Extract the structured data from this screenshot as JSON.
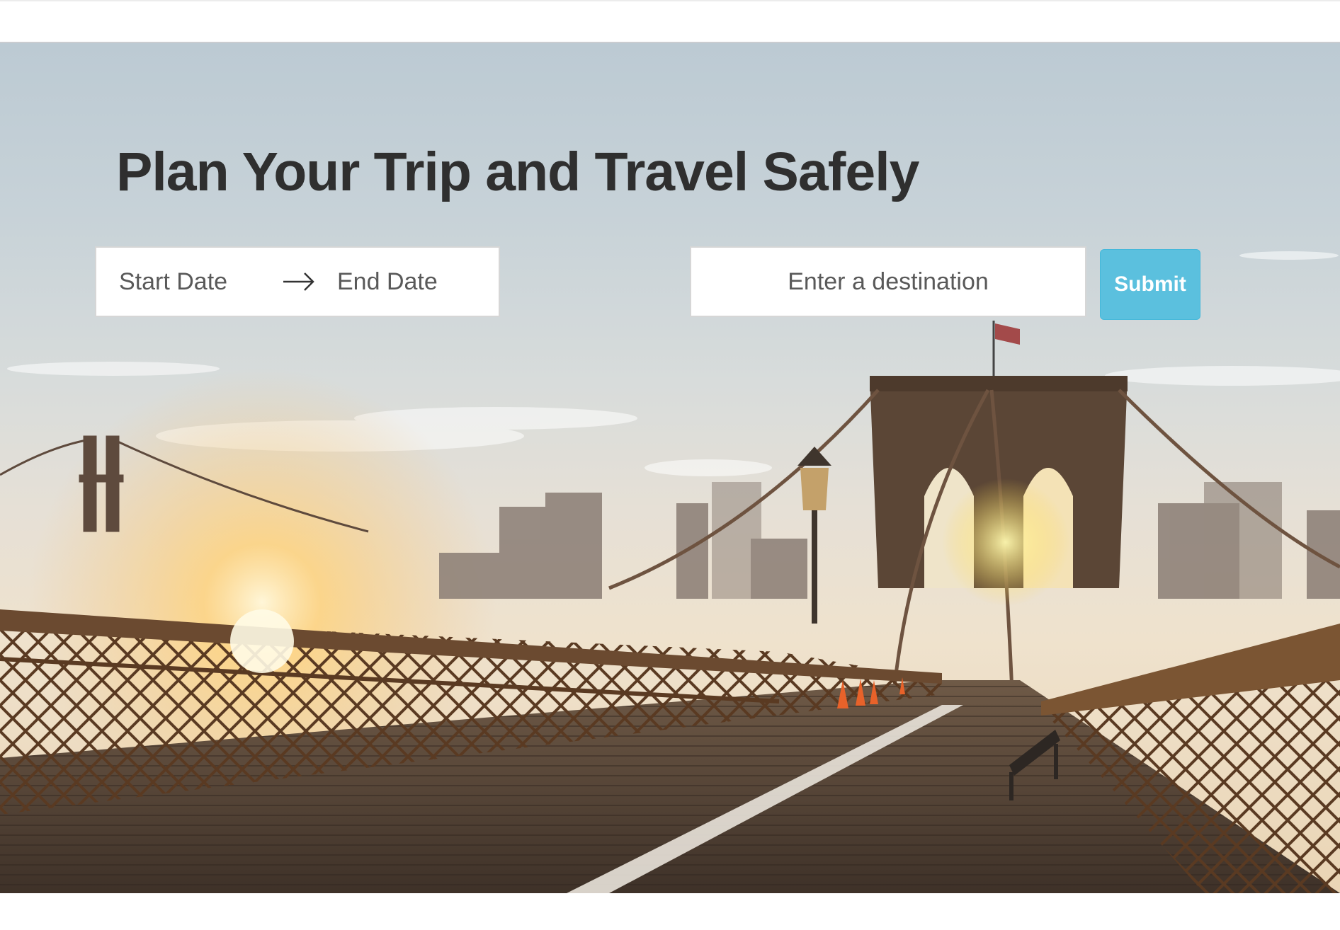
{
  "header": {
    "title": "Plan Your Trip and Travel Safely"
  },
  "search": {
    "start_date_placeholder": "Start Date",
    "end_date_placeholder": "End Date",
    "destination_placeholder": "Enter a destination",
    "submit_label": "Submit",
    "arrow_icon": "arrow-right-icon"
  },
  "hero": {
    "image_subject": "brooklyn-bridge-at-sunrise"
  },
  "colors": {
    "submit_bg": "#5bc0de",
    "title_text": "#2f2f2f"
  }
}
